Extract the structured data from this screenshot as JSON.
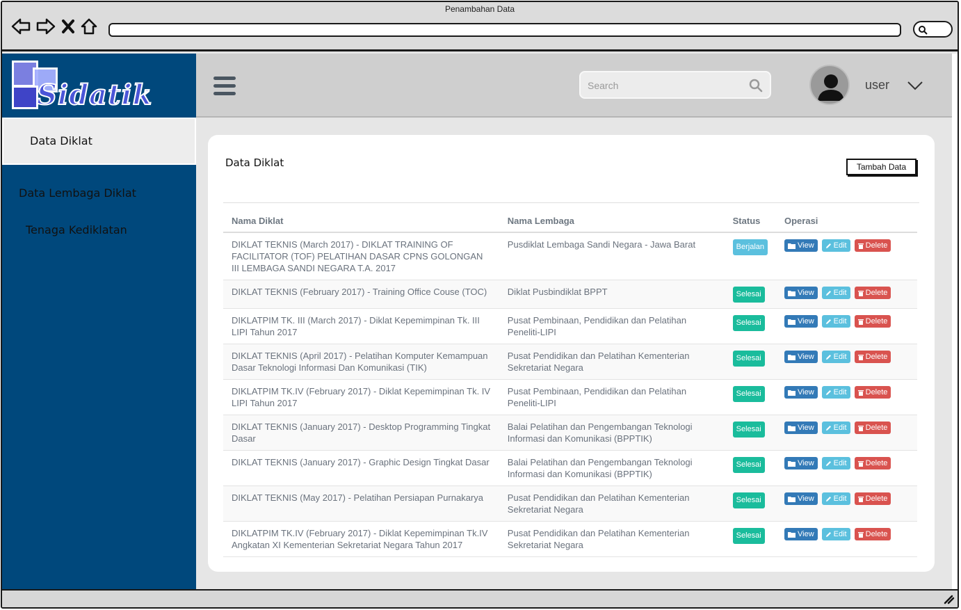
{
  "browser": {
    "window_title": "Penambahan Data",
    "url": ""
  },
  "logo": {
    "text": "Sidatik"
  },
  "sidebar": {
    "items": [
      {
        "label": "Data Diklat",
        "active": true
      },
      {
        "label": "Data Lembaga Diklat",
        "active": false
      },
      {
        "label": "Tenaga Kediklatan",
        "active": false
      }
    ]
  },
  "header": {
    "search_placeholder": "Search",
    "user_label": "user"
  },
  "main": {
    "title": "Data Diklat",
    "add_button": "Tambah Data",
    "columns": [
      "Nama Diklat",
      "Nama Lembaga",
      "Status",
      "Operasi"
    ],
    "actions": {
      "view": "View",
      "edit": "Edit",
      "delete": "Delete"
    },
    "rows": [
      {
        "nama_diklat": "DIKLAT TEKNIS (March 2017) - DIKLAT TRAINING OF FACILITATOR (TOF) PELATIHAN DASAR CPNS GOLONGAN III LEMBAGA SANDI NEGARA T.A. 2017",
        "nama_lembaga": "Pusdiklat Lembaga Sandi Negara - Jawa Barat",
        "status": "Berjalan"
      },
      {
        "nama_diklat": "DIKLAT TEKNIS (February 2017) - Training Office Couse (TOC)",
        "nama_lembaga": "Diklat Pusbindiklat BPPT",
        "status": "Selesai"
      },
      {
        "nama_diklat": "DIKLATPIM TK. III (March 2017) - Diklat Kepemimpinan Tk. III LIPI Tahun 2017",
        "nama_lembaga": "Pusat Pembinaan, Pendidikan dan Pelatihan Peneliti-LIPI",
        "status": "Selesai"
      },
      {
        "nama_diklat": "DIKLAT TEKNIS (April 2017) - Pelatihan Komputer Kemampuan Dasar Teknologi Informasi Dan Komunikasi (TIK)",
        "nama_lembaga": "Pusat Pendidikan dan Pelatihan Kementerian Sekretariat Negara",
        "status": "Selesai"
      },
      {
        "nama_diklat": "DIKLATPIM TK.IV (February 2017) - Diklat Kepemimpinan Tk. IV LIPI Tahun 2017",
        "nama_lembaga": "Pusat Pembinaan, Pendidikan dan Pelatihan Peneliti-LIPI",
        "status": "Selesai"
      },
      {
        "nama_diklat": "DIKLAT TEKNIS (January 2017) - Desktop Programming Tingkat Dasar",
        "nama_lembaga": "Balai Pelatihan dan Pengembangan Teknologi Informasi dan Komunikasi (BPPTIK)",
        "status": "Selesai"
      },
      {
        "nama_diklat": "DIKLAT TEKNIS (January 2017) - Graphic Design Tingkat Dasar",
        "nama_lembaga": "Balai Pelatihan dan Pengembangan Teknologi Informasi dan Komunikasi (BPPTIK)",
        "status": "Selesai"
      },
      {
        "nama_diklat": "DIKLAT TEKNIS (May 2017) - Pelatihan Persiapan Purnakarya",
        "nama_lembaga": "Pusat Pendidikan dan Pelatihan Kementerian Sekretariat Negara",
        "status": "Selesai"
      },
      {
        "nama_diklat": "DIKLATPIM TK.IV (February 2017) - Diklat Kepemimpinan Tk.IV Angkatan XI Kementerian Sekretariat Negara Tahun 2017",
        "nama_lembaga": "Pusat Pendidikan dan Pelatihan Kementerian Sekretariat Negara",
        "status": "Selesai"
      }
    ]
  },
  "colors": {
    "sidebar_bg": "#00487c",
    "status_running": "#5bc0de",
    "status_done": "#1abc9c",
    "view_button": "#337ab7",
    "edit_button": "#5bc0de",
    "delete_button": "#d9534f"
  },
  "icons": {
    "back": "arrow-left-icon",
    "forward": "arrow-right-icon",
    "stop": "close-icon",
    "home": "home-icon",
    "search": "search-icon",
    "menu": "hamburger-icon",
    "user": "user-avatar-icon",
    "dropdown": "chevron-down-icon",
    "view": "folder-icon",
    "edit": "pencil-icon",
    "delete": "trash-icon"
  }
}
